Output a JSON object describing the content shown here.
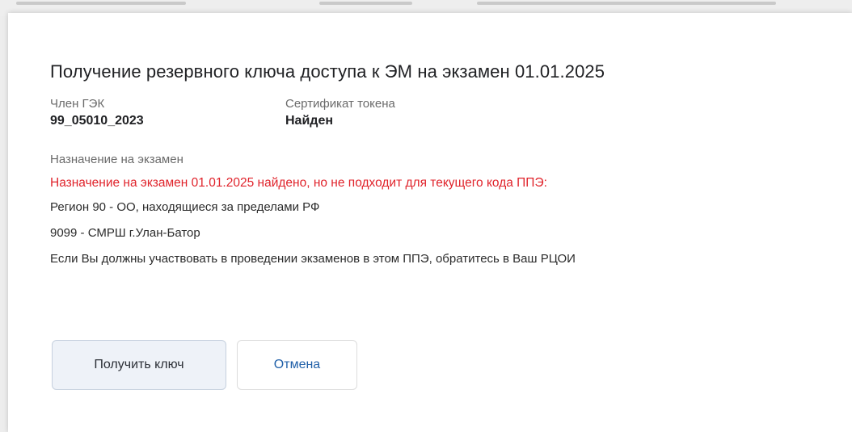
{
  "dialog": {
    "title": "Получение резервного ключа доступа к ЭМ на экзамен 01.01.2025",
    "member": {
      "label": "Член ГЭК",
      "value": "99_05010_2023"
    },
    "certificate": {
      "label": "Сертификат токена",
      "value": "Найден"
    },
    "assignment": {
      "label": "Назначение на экзамен",
      "warning": "Назначение на экзамен 01.01.2025 найдено, но не подходит для текущего кода ППЭ:",
      "region": "Регион 90 - ОО, находящиеся за пределами РФ",
      "ppe": "9099 - СМРШ г.Улан-Батор",
      "advice": "Если Вы должны участвовать в проведении экзаменов в этом ППЭ, обратитесь в Ваш РЦОИ"
    },
    "buttons": {
      "get_key": "Получить ключ",
      "cancel": "Отмена"
    },
    "colors": {
      "warning": "#e0232b",
      "link": "#1f5fa8",
      "primary_bg": "#eef2f8"
    }
  }
}
